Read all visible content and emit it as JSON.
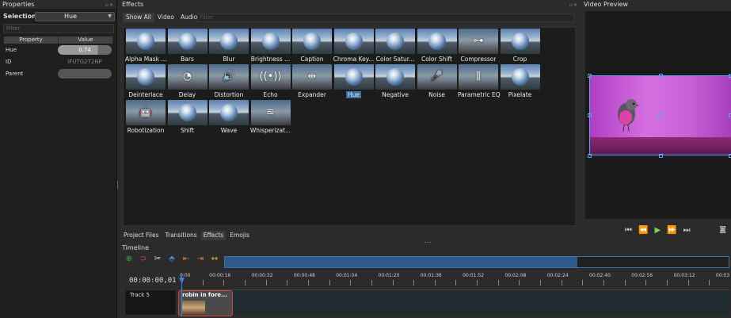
{
  "properties": {
    "title": "Properties",
    "selection_label": "Selection:",
    "selection_value": "Hue",
    "filter_placeholder": "Filter",
    "col_property": "Property",
    "col_value": "Value",
    "rows": [
      {
        "key": "Hue",
        "value": "0.74",
        "fraction": 0.74
      },
      {
        "key": "ID",
        "value": "IFUTG2T2NP"
      },
      {
        "key": "Parent",
        "value": ""
      }
    ]
  },
  "effects": {
    "title": "Effects",
    "tabs": [
      "Show All",
      "Video",
      "Audio"
    ],
    "filter_placeholder": "Filter",
    "items": [
      {
        "label": "Alpha Mask ...",
        "icon": "orb"
      },
      {
        "label": "Bars",
        "icon": "orb"
      },
      {
        "label": "Blur",
        "icon": "orb"
      },
      {
        "label": "Brightness ...",
        "icon": "orb"
      },
      {
        "label": "Caption",
        "icon": "orb"
      },
      {
        "label": "Chroma Key...",
        "icon": "orb"
      },
      {
        "label": "Color Satur...",
        "icon": "orb"
      },
      {
        "label": "Color Shift",
        "icon": "orb"
      },
      {
        "label": "Compressor",
        "icon": "compressor"
      },
      {
        "label": "Crop",
        "icon": "orb"
      },
      {
        "label": "Deinterlace",
        "icon": "orb"
      },
      {
        "label": "Delay",
        "icon": "delay"
      },
      {
        "label": "Distortion",
        "icon": "speaker"
      },
      {
        "label": "Echo",
        "icon": "echo"
      },
      {
        "label": "Expander",
        "icon": "expander"
      },
      {
        "label": "Hue",
        "icon": "orb",
        "selected": true
      },
      {
        "label": "Negative",
        "icon": "orb"
      },
      {
        "label": "Noise",
        "icon": "mic"
      },
      {
        "label": "Parametric EQ",
        "icon": "eq"
      },
      {
        "label": "Pixelate",
        "icon": "orb"
      },
      {
        "label": "Robotization",
        "icon": "robot"
      },
      {
        "label": "Shift",
        "icon": "orb"
      },
      {
        "label": "Wave",
        "icon": "orb"
      },
      {
        "label": "Whisperizat...",
        "icon": "whisper"
      }
    ]
  },
  "preview": {
    "title": "Video Preview"
  },
  "bottom_tabs": [
    "Project Files",
    "Transitions",
    "Effects",
    "Emojis"
  ],
  "bottom_tab_active": 2,
  "timeline": {
    "title": "Timeline",
    "timecode": "00:00:00,01",
    "ruler_labels": [
      "0:00",
      "00:00:16",
      "00:00:32",
      "00:00:48",
      "00:01:04",
      "00:01:20",
      "00:01:36",
      "00:01:52",
      "00:02:08",
      "00:02:24",
      "00:02:40",
      "00:02:56",
      "00:03:12",
      "00:03"
    ],
    "track_name": "Track 5",
    "clip_name": "robin in fore..."
  },
  "colors": {
    "accent": "#3a6ea5",
    "add_button": "#3cb043",
    "play": "#7fd34e"
  }
}
